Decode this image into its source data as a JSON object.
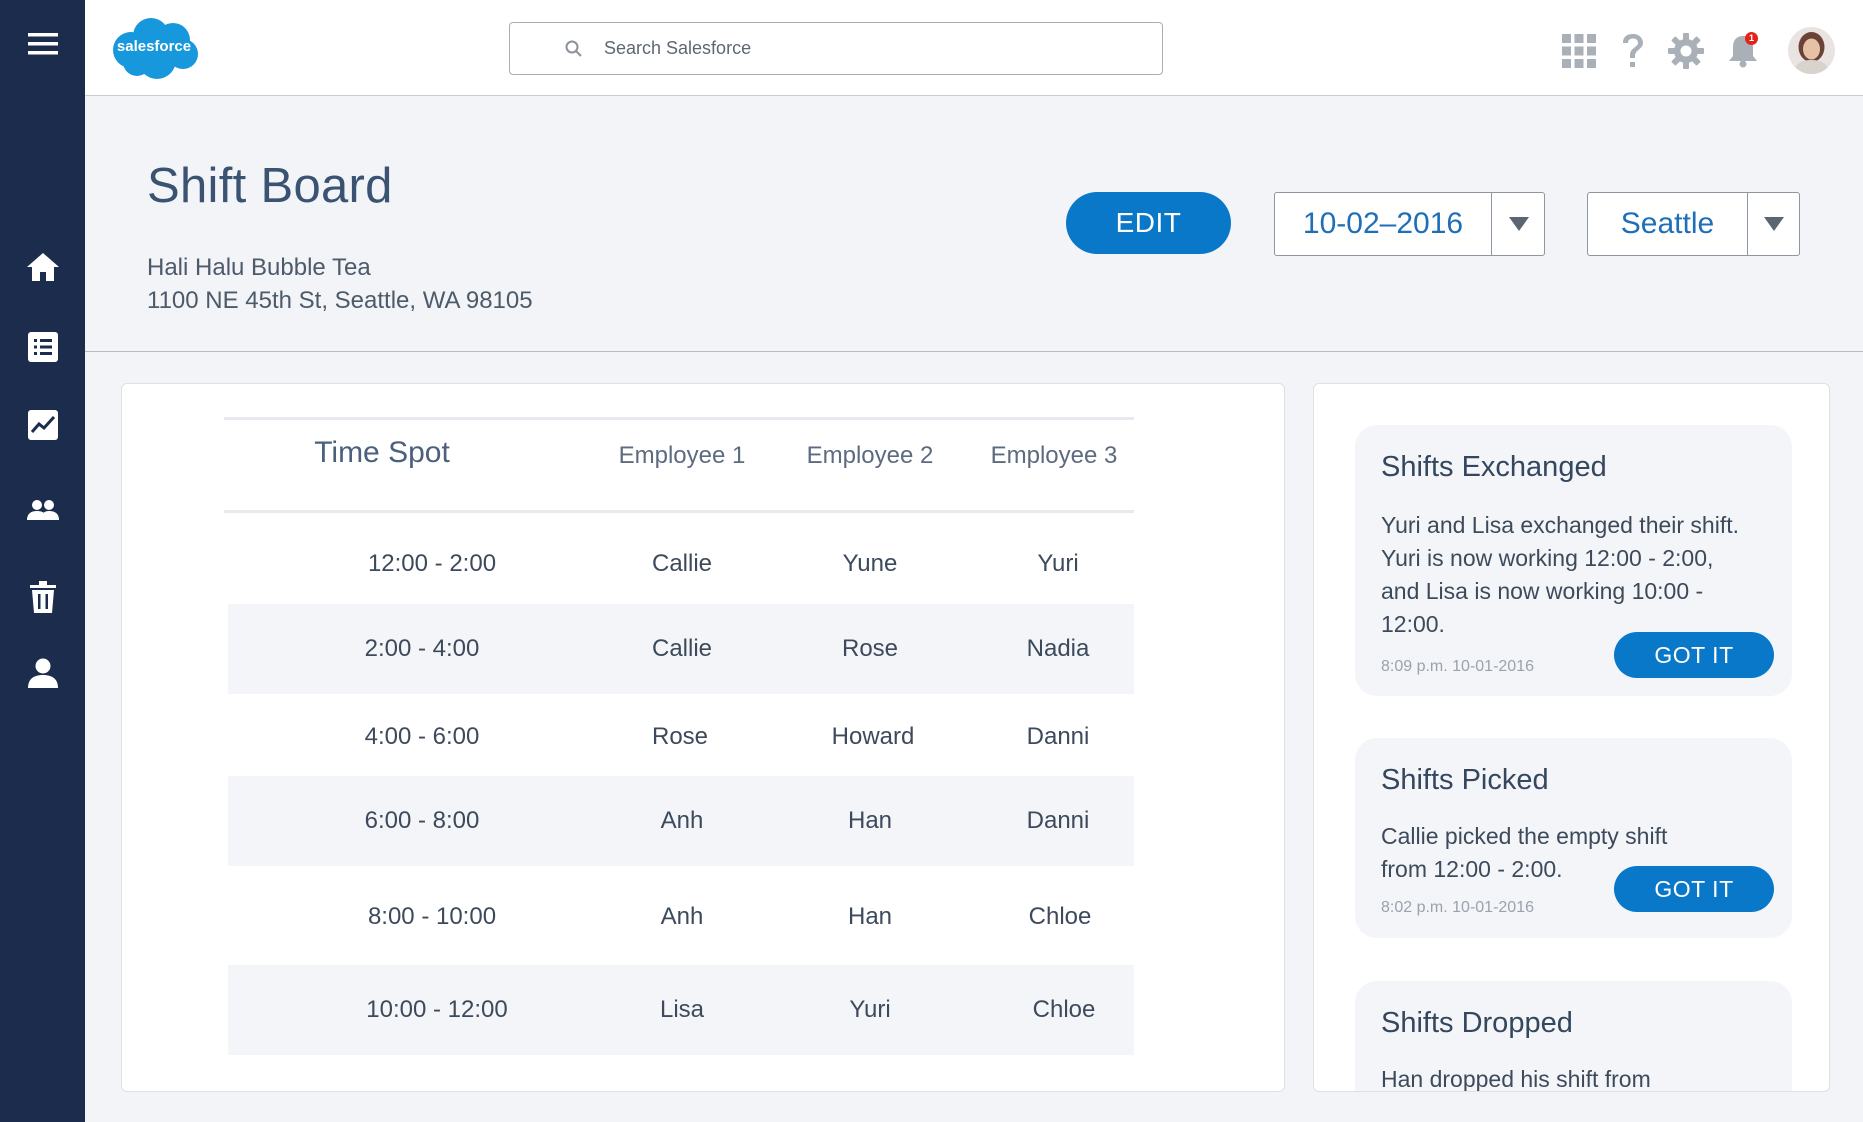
{
  "brand": {
    "logo_text": "salesforce",
    "cloud_color": "#1798dc"
  },
  "search": {
    "placeholder": "Search Salesforce"
  },
  "header": {
    "icons": [
      "app-launcher-icon",
      "help-icon",
      "setup-gear-icon",
      "notifications-bell-icon",
      "avatar"
    ],
    "notification_count": "1"
  },
  "sidebar": {
    "items": [
      {
        "name": "menu",
        "icon": "hamburger-menu-icon"
      },
      {
        "name": "home",
        "icon": "home-icon"
      },
      {
        "name": "list",
        "icon": "list-icon"
      },
      {
        "name": "reports",
        "icon": "chart-line-icon"
      },
      {
        "name": "people",
        "icon": "people-icon"
      },
      {
        "name": "trash",
        "icon": "trash-icon"
      },
      {
        "name": "profile",
        "icon": "user-icon"
      }
    ]
  },
  "page": {
    "title": "Shift Board",
    "business_name": "Hali Halu Bubble Tea",
    "address": "1100 NE 45th St, Seattle, WA 98105",
    "edit_label": "EDIT",
    "date_value": "10-02–2016",
    "location_value": "Seattle"
  },
  "schedule": {
    "headers": [
      "Time Spot",
      "Employee 1",
      "Employee 2",
      "Employee 3"
    ],
    "rows": [
      {
        "time": "12:00 - 2:00",
        "e1": "Callie",
        "e2": "Yune",
        "e3": "Yuri"
      },
      {
        "time": "2:00 - 4:00",
        "e1": "Callie",
        "e2": "Rose",
        "e3": "Nadia"
      },
      {
        "time": "4:00 - 6:00",
        "e1": "Rose",
        "e2": "Howard",
        "e3": "Danni"
      },
      {
        "time": "6:00 - 8:00",
        "e1": "Anh",
        "e2": "Han",
        "e3": "Danni"
      },
      {
        "time": "8:00 - 10:00",
        "e1": "Anh",
        "e2": "Han",
        "e3": "Chloe"
      },
      {
        "time": "10:00 - 12:00",
        "e1": "Lisa",
        "e2": "Yuri",
        "e3": "Chloe"
      }
    ]
  },
  "notifications": [
    {
      "title": "Shifts Exchanged",
      "body": "Yuri and Lisa exchanged their shift. Yuri is now working 12:00 - 2:00, and Lisa is now working 10:00 - 12:00.",
      "time": "8:09 p.m.   10-01-2016",
      "button": "GOT IT"
    },
    {
      "title": "Shifts Picked",
      "body": "Callie picked the empty shift from 12:00 - 2:00.",
      "time": "8:02 p.m.   10-01-2016",
      "button": "GOT IT"
    },
    {
      "title": "Shifts Dropped",
      "body": "Han dropped his shift from",
      "time": "",
      "button": ""
    }
  ],
  "colors": {
    "accent": "#0a78c8",
    "sidebar": "#1c2c4c",
    "background": "#f3f4f7"
  }
}
